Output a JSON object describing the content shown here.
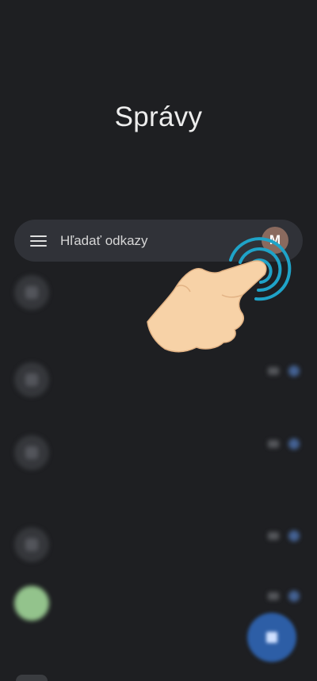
{
  "screen": {
    "title": "Správy"
  },
  "search": {
    "placeholder": "Hľadať odkazy",
    "avatar_letter": "M"
  },
  "conversations": [
    {
      "name": "",
      "lines": [
        "",
        "",
        ""
      ],
      "avatar": "default"
    },
    {
      "name": "",
      "lines": [
        "",
        ""
      ],
      "avatar": "default"
    },
    {
      "name": "",
      "lines": [
        "",
        "",
        ""
      ],
      "avatar": "default"
    },
    {
      "name": "",
      "lines": [
        ""
      ],
      "avatar": "default"
    },
    {
      "name": "",
      "lines": [
        "",
        "",
        ""
      ],
      "avatar": "green"
    }
  ],
  "colors": {
    "background": "#1e1f22",
    "searchbar": "#303238",
    "fab": "#2d5ea6",
    "tap_ring": "#1fa3c8",
    "hand": "#f7d2a7"
  },
  "icons": {
    "menu": "hamburger-icon",
    "fab": "compose-icon",
    "overlay": "tap-hand-icon"
  }
}
